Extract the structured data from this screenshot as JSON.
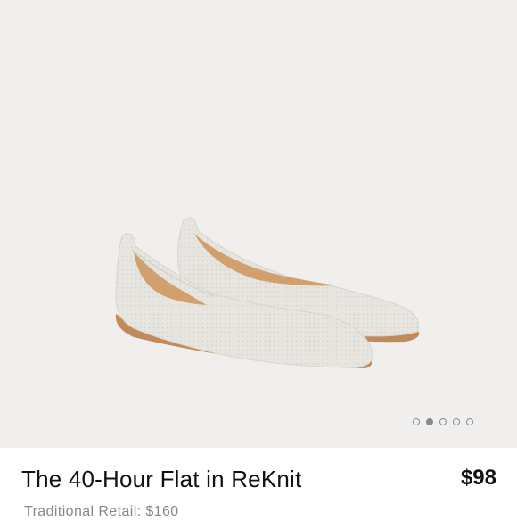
{
  "product": {
    "title": "The 40-Hour Flat in ReKnit",
    "price": "$98",
    "retail_label": "Traditional Retail: $160"
  },
  "gallery": {
    "image_subject": "white knit pointed-toe flats",
    "dots": 5,
    "active_dot": 1
  },
  "colors": {
    "background": "#f0efed",
    "knit": "#e6e4df",
    "sole": "#c08a5a",
    "lining": "#d2a06e",
    "dot": "#8a8a8a"
  }
}
